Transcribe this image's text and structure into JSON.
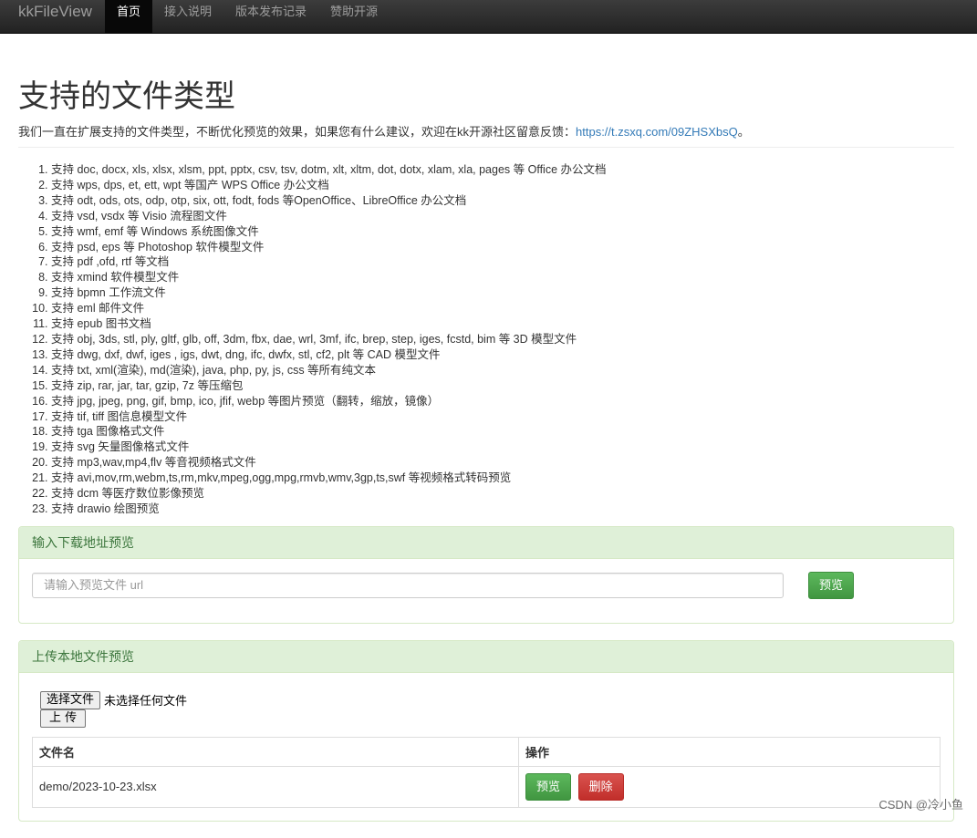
{
  "nav": {
    "brand": "kkFileView",
    "items": [
      {
        "label": "首页",
        "active": true
      },
      {
        "label": "接入说明"
      },
      {
        "label": "版本发布记录"
      },
      {
        "label": "赞助开源"
      }
    ]
  },
  "header": {
    "title": "支持的文件类型",
    "lead_text": "我们一直在扩展支持的文件类型，不断优化预览的效果，如果您有什么建议，欢迎在kk开源社区留意反馈：",
    "lead_link": "https://t.zsxq.com/09ZHSXbsQ",
    "lead_end": "。"
  },
  "file_types": [
    "支持 doc, docx, xls, xlsx, xlsm, ppt, pptx, csv, tsv, dotm, xlt, xltm, dot, dotx, xlam, xla, pages 等 Office 办公文档",
    "支持 wps, dps, et, ett, wpt 等国产 WPS Office 办公文档",
    "支持 odt, ods, ots, odp, otp, six, ott, fodt, fods 等OpenOffice、LibreOffice 办公文档",
    "支持 vsd, vsdx 等 Visio 流程图文件",
    "支持 wmf, emf 等 Windows 系统图像文件",
    "支持 psd, eps 等 Photoshop 软件模型文件",
    "支持 pdf ,ofd, rtf 等文档",
    "支持 xmind 软件模型文件",
    "支持 bpmn 工作流文件",
    "支持 eml 邮件文件",
    "支持 epub 图书文档",
    "支持 obj, 3ds, stl, ply, gltf, glb, off, 3dm, fbx, dae, wrl, 3mf, ifc, brep, step, iges, fcstd, bim 等 3D 模型文件",
    "支持 dwg, dxf, dwf, iges , igs, dwt, dng, ifc, dwfx, stl, cf2, plt 等 CAD 模型文件",
    "支持 txt, xml(渲染), md(渲染), java, php, py, js, css 等所有纯文本",
    "支持 zip, rar, jar, tar, gzip, 7z 等压缩包",
    "支持 jpg, jpeg, png, gif, bmp, ico, jfif, webp 等图片预览（翻转，缩放，镜像）",
    "支持 tif, tiff 图信息模型文件",
    "支持 tga 图像格式文件",
    "支持 svg 矢量图像格式文件",
    "支持 mp3,wav,mp4,flv 等音视频格式文件",
    "支持 avi,mov,rm,webm,ts,rm,mkv,mpeg,ogg,mpg,rmvb,wmv,3gp,ts,swf 等视频格式转码预览",
    "支持 dcm 等医疗数位影像预览",
    "支持 drawio 绘图预览"
  ],
  "url_panel": {
    "title": "输入下载地址预览",
    "placeholder": "请输入预览文件 url",
    "value": "",
    "button": "预览"
  },
  "upload_panel": {
    "title": "上传本地文件预览",
    "choose_button": "选择文件",
    "no_file": "未选择任何文件",
    "upload_button": "上 传",
    "table": {
      "headers": [
        "文件名",
        "操作"
      ],
      "rows": [
        {
          "name": "demo/2023-10-23.xlsx",
          "preview": "预览",
          "delete": "删除"
        }
      ]
    }
  },
  "watermark": "CSDN @冷小鱼",
  "colors": {
    "success": "#5cb85c",
    "danger": "#d9534f",
    "panel_heading": "#dff0d8",
    "link": "#337ab7"
  }
}
